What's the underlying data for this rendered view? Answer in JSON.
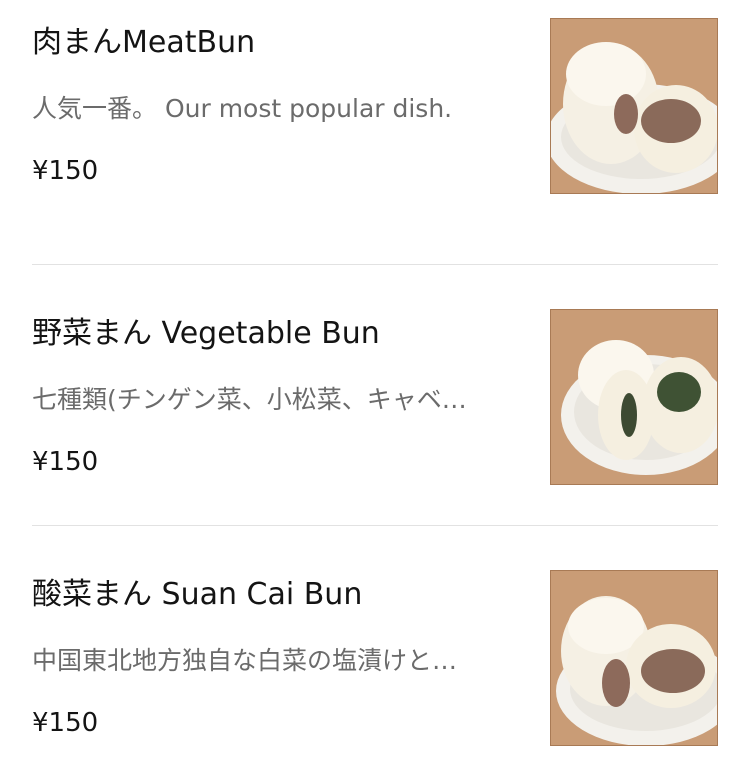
{
  "menu": {
    "items": [
      {
        "name": "肉まんMeatBun",
        "description": "人気一番。 Our most popular dish.",
        "price": "¥150",
        "image": "meat-bun-photo"
      },
      {
        "name": "野菜まん Vegetable Bun",
        "description": "七種類(チンゲン菜、小松菜、キャベ…",
        "price": "¥150",
        "image": "vegetable-bun-photo"
      },
      {
        "name": "酸菜まん Suan Cai Bun",
        "description": "中国東北地方独自な白菜の塩漬けと…",
        "price": "¥150",
        "image": "suan-cai-bun-photo"
      }
    ]
  },
  "colors": {
    "title": "#141414",
    "description": "#6b6b6b",
    "divider": "#e2e2e2",
    "photo_background": "#c79a74"
  }
}
